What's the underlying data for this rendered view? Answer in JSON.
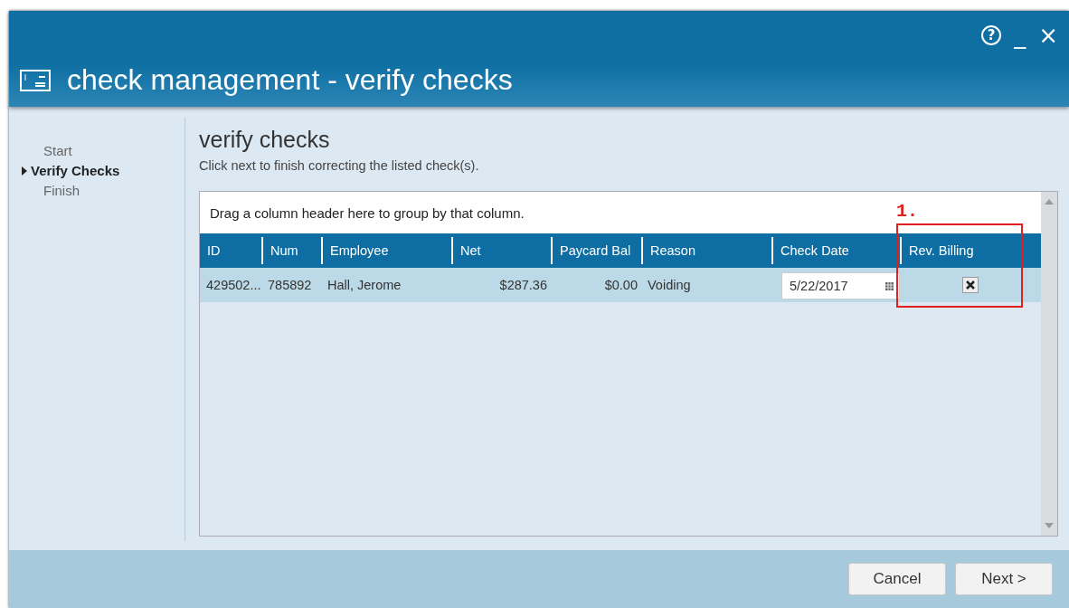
{
  "window": {
    "title": "check management - verify checks",
    "controls": [
      "?",
      "_",
      "×"
    ]
  },
  "steps": [
    {
      "label": "Start",
      "selected": false
    },
    {
      "label": "Verify Checks",
      "selected": true
    },
    {
      "label": "Finish",
      "selected": false
    }
  ],
  "page": {
    "heading": "verify checks",
    "instructions": "Click next to finish correcting the listed check(s)."
  },
  "grid": {
    "group_hint": "Drag a column header here to group by that column.",
    "columns": [
      "ID",
      "Num",
      "Employee",
      "Net",
      "Paycard Bal",
      "Reason",
      "Check Date",
      "Rev. Billing"
    ],
    "rows": [
      {
        "id": "429502...",
        "num": "785892",
        "employee": "Hall, Jerome",
        "net": "$287.36",
        "paycard_bal": "$0.00",
        "reason": "Voiding",
        "check_date": "5/22/2017",
        "rev_billing_checked": true
      }
    ]
  },
  "annotation": {
    "label": "1."
  },
  "buttons": [
    "Cancel",
    "Next >"
  ]
}
